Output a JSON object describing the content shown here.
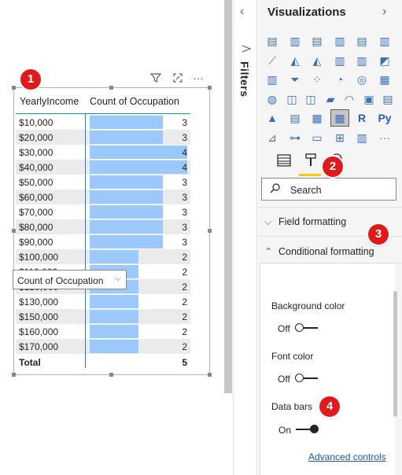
{
  "table": {
    "col_income": "YearlyIncome",
    "col_count": "Count of Occupation",
    "rows": [
      {
        "income": "$10,000",
        "count": "3",
        "value": 3
      },
      {
        "income": "$20,000",
        "count": "3",
        "value": 3
      },
      {
        "income": "$30,000",
        "count": "4",
        "value": 4
      },
      {
        "income": "$40,000",
        "count": "4",
        "value": 4
      },
      {
        "income": "$50,000",
        "count": "3",
        "value": 3
      },
      {
        "income": "$60,000",
        "count": "3",
        "value": 3
      },
      {
        "income": "$70,000",
        "count": "3",
        "value": 3
      },
      {
        "income": "$80,000",
        "count": "3",
        "value": 3
      },
      {
        "income": "$90,000",
        "count": "3",
        "value": 3
      },
      {
        "income": "$100,000",
        "count": "2",
        "value": 2
      },
      {
        "income": "$110,000",
        "count": "2",
        "value": 2
      },
      {
        "income": "$120,000",
        "count": "2",
        "value": 2
      },
      {
        "income": "$130,000",
        "count": "2",
        "value": 2
      },
      {
        "income": "$150,000",
        "count": "2",
        "value": 2
      },
      {
        "income": "$160,000",
        "count": "2",
        "value": 2
      },
      {
        "income": "$170,000",
        "count": "2",
        "value": 2
      }
    ],
    "total_label": "Total",
    "total_value": "5",
    "bar_max": 4,
    "bar_color": "#9cc9fb"
  },
  "badges": [
    "1",
    "2",
    "3",
    "4"
  ],
  "filters": {
    "label": "Filters"
  },
  "viz": {
    "title": "Visualizations",
    "search_placeholder": "Search",
    "sections": {
      "field_formatting": "Field formatting",
      "conditional_formatting": "Conditional formatting"
    },
    "dropdown_value": "Count of Occupation",
    "background_color": {
      "label": "Background color",
      "state": "Off"
    },
    "font_color": {
      "label": "Font color",
      "state": "Off"
    },
    "data_bars": {
      "label": "Data bars",
      "state": "On"
    },
    "advanced_controls": "Advanced controls",
    "grid_icons": [
      "stacked-bar-icon",
      "stacked-column-icon",
      "clustered-bar-icon",
      "clustered-column-icon",
      "100-bar-icon",
      "100-column-icon",
      "line-chart-icon",
      "area-chart-icon",
      "stacked-area-icon",
      "line-column-icon",
      "line-column-2-icon",
      "ribbon-icon",
      "waterfall-icon",
      "funnel-icon",
      "scatter-icon",
      "pie-icon",
      "donut-icon",
      "treemap-icon",
      "map-icon",
      "filled-map-icon",
      "shape-map-icon",
      "arcgis-icon",
      "gauge-icon",
      "card-icon",
      "multirow-card-icon",
      "kpi-icon",
      "slicer-icon",
      "table-icon",
      "matrix-icon",
      "r-visual-icon",
      "python-visual-icon",
      "key-influencers-icon",
      "decomposition-tree-icon",
      "qa-icon",
      "smart-narrative-icon",
      "paginated-icon",
      "more-icon"
    ],
    "grid_glyphs": {
      "r": "R",
      "py": "Py",
      "card": "123",
      "more": "···"
    }
  }
}
